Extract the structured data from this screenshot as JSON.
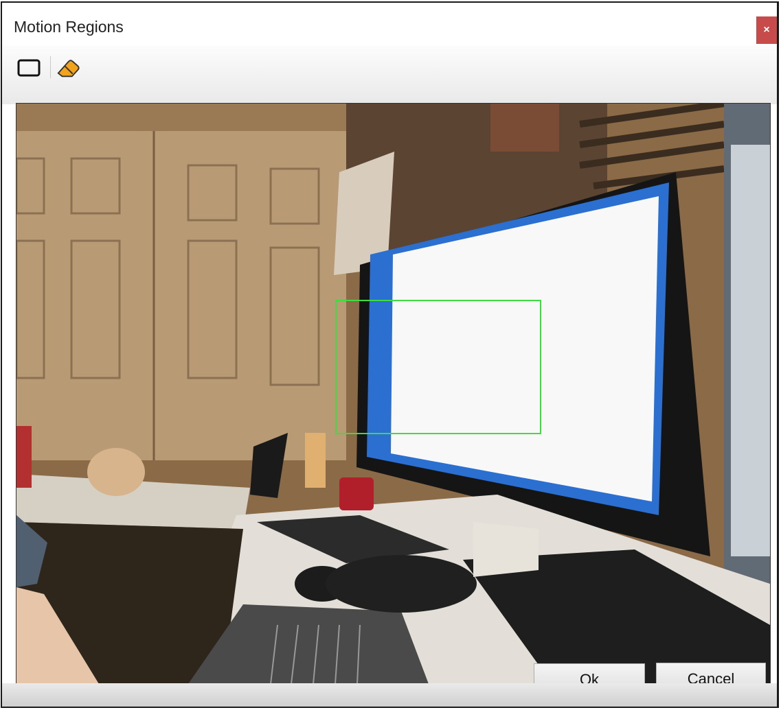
{
  "window": {
    "title": "Motion Regions",
    "close_glyph": "×"
  },
  "toolbar": {
    "tools": [
      {
        "name": "rectangle-tool",
        "icon": "rectangle-outline-icon"
      },
      {
        "name": "eraser-tool",
        "icon": "eraser-icon"
      }
    ]
  },
  "preview": {
    "description_icon": "camera-preview",
    "region_color": "#3fdc3f"
  },
  "buttons": {
    "ok_label": "Ok",
    "cancel_label": "Cancel"
  },
  "colors": {
    "close": "#c74b4b",
    "eraser": "#f2a21b"
  }
}
